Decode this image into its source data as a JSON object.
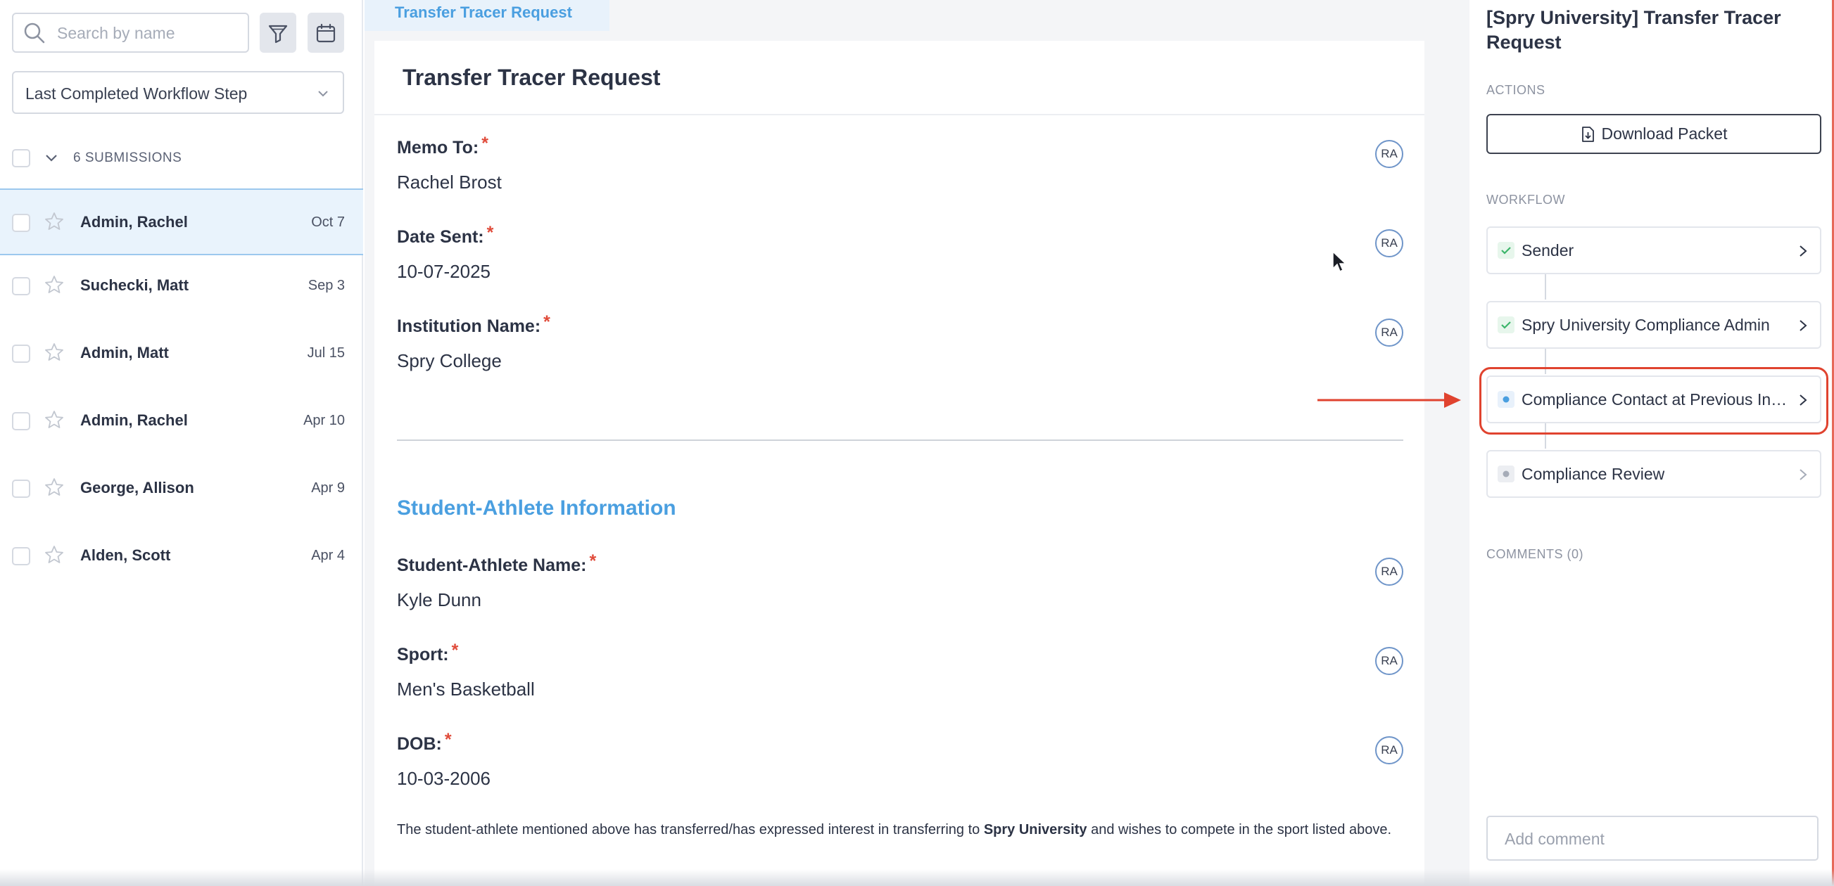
{
  "sidebar": {
    "search_placeholder": "Search by name",
    "filter_select_value": "Last Completed Workflow Step",
    "submissions_count_label": "6 SUBMISSIONS",
    "rows": [
      {
        "name": "Admin, Rachel",
        "date": "Oct 7",
        "active": true
      },
      {
        "name": "Suchecki, Matt",
        "date": "Sep 3",
        "active": false
      },
      {
        "name": "Admin, Matt",
        "date": "Jul 15",
        "active": false
      },
      {
        "name": "Admin, Rachel",
        "date": "Apr 10",
        "active": false
      },
      {
        "name": "George, Allison",
        "date": "Apr 9",
        "active": false
      },
      {
        "name": "Alden, Scott",
        "date": "Apr 4",
        "active": false
      }
    ]
  },
  "form": {
    "tab_label": "Transfer Tracer Request",
    "title": "Transfer Tracer Request",
    "fields": [
      {
        "label": "Memo To:",
        "value": "Rachel Brost",
        "badge": "RA"
      },
      {
        "label": "Date Sent:",
        "value": "10-07-2025",
        "badge": "RA"
      },
      {
        "label": "Institution Name:",
        "value": "Spry College",
        "badge": "RA"
      }
    ],
    "section_title": "Student-Athlete Information",
    "section_fields": [
      {
        "label": "Student-Athlete Name:",
        "value": "Kyle Dunn",
        "badge": "RA"
      },
      {
        "label": "Sport:",
        "value": "Men's Basketball",
        "badge": "RA"
      },
      {
        "label": "DOB:",
        "value": "10-03-2006",
        "badge": "RA"
      }
    ],
    "required_mark": "*",
    "note_before": "The student-athlete mentioned above has transferred/has expressed interest in transferring to ",
    "note_bold": "Spry University",
    "note_after": " and wishes to compete in the sport listed above."
  },
  "panel": {
    "title": "[Spry University] Transfer Tracer Request",
    "actions_label": "ACTIONS",
    "download_label": "Download Packet",
    "workflow_label": "WORKFLOW",
    "workflow_steps": [
      {
        "label": "Sender",
        "status": "done"
      },
      {
        "label": "Spry University Compliance Admin",
        "status": "done"
      },
      {
        "label": "Compliance Contact at Previous Institution",
        "status": "current"
      },
      {
        "label": "Compliance Review",
        "status": "pending"
      }
    ],
    "comments_label": "COMMENTS (0)",
    "comment_placeholder": "Add comment"
  },
  "colors": {
    "accent": "#4a9fe0",
    "required": "#e04b3a",
    "annotation": "#e0432f",
    "done": "#3bb56a"
  }
}
